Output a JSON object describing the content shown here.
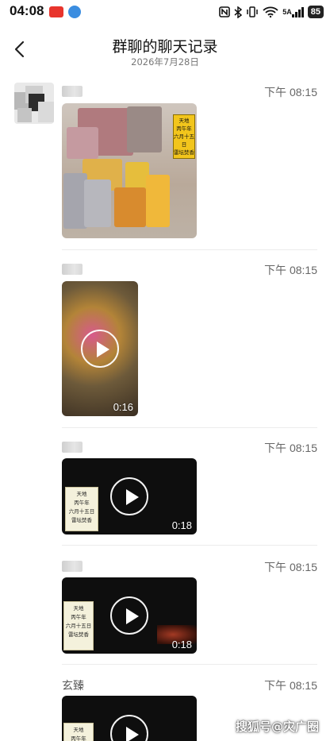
{
  "status_bar": {
    "time": "04:08",
    "network": "5A",
    "battery": "85",
    "icons": [
      "red-app-icon",
      "blue-app-icon",
      "nfc-icon",
      "bluetooth-icon",
      "vibrate-icon",
      "wifi-icon",
      "signal-icon",
      "battery-icon"
    ]
  },
  "header": {
    "title": "群聊的聊天记录",
    "subtitle": "2026年7月28日",
    "back_icon": "chevron-left-icon"
  },
  "messages": [
    {
      "sender": "",
      "time": "下午 08:15",
      "type": "image"
    },
    {
      "sender": "",
      "time": "下午 08:15",
      "type": "video",
      "duration": "0:16"
    },
    {
      "sender": "",
      "time": "下午 08:15",
      "type": "video",
      "duration": "0:18"
    },
    {
      "sender": "",
      "time": "下午 08:15",
      "type": "video",
      "duration": "0:18"
    },
    {
      "sender": "玄臻",
      "time": "下午 08:15",
      "type": "video",
      "duration": ""
    }
  ],
  "sign_text": [
    "天地",
    "丙午年",
    "六月十五日",
    "雷坛焚香"
  ],
  "watermark": "搜狐号@灾广圈",
  "colors": {
    "background": "#ffffff",
    "text_primary": "#111111",
    "text_secondary": "#666666",
    "sign_yellow": "#f2c51c"
  }
}
